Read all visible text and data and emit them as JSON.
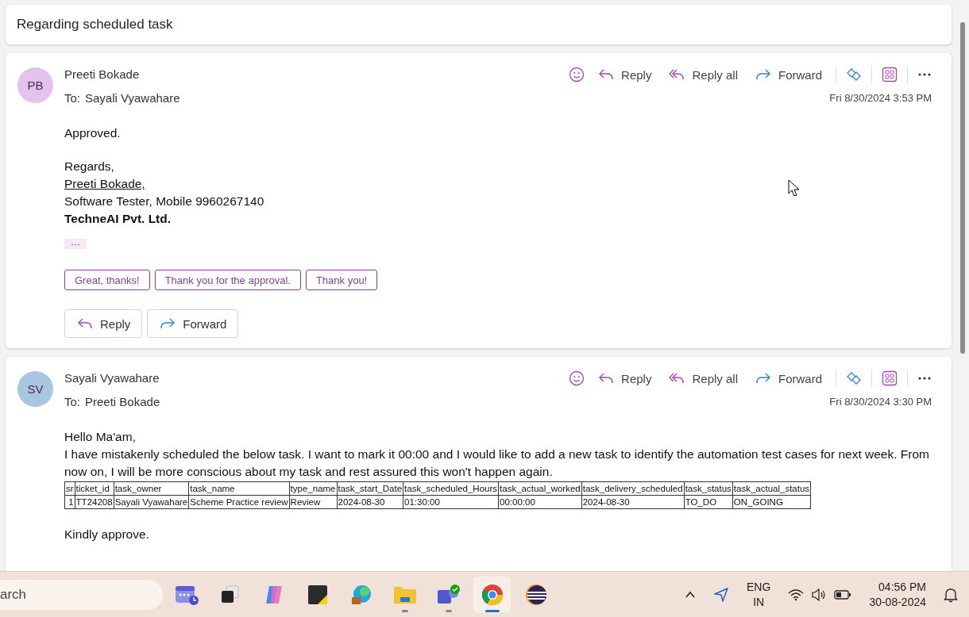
{
  "subject": "Regarding scheduled task",
  "messages": [
    {
      "initials": "PB",
      "color": "#e5c2ec",
      "sender": "Preeti Bokade",
      "to_label": "To:",
      "recipient": "Sayali Vyawahare",
      "date": "Fri 8/30/2024 3:53 PM",
      "actions": [
        {
          "kind": "reply",
          "label": "Reply"
        },
        {
          "kind": "reply-all",
          "label": "Reply all"
        },
        {
          "kind": "forward",
          "label": "Forward"
        }
      ],
      "body": [
        {
          "kind": "plain",
          "text": "Approved."
        },
        {
          "kind": "gap"
        },
        {
          "kind": "plain",
          "text": "Regards,"
        },
        {
          "kind": "link",
          "text": "Preeti Bokade,"
        },
        {
          "kind": "plain",
          "text": "Software Tester, Mobile 9960267140"
        },
        {
          "kind": "bold",
          "text": "TechneAI Pvt. Ltd."
        }
      ],
      "show_more": "···",
      "quick_replies": [
        "Great, thanks!",
        "Thank you for the approval.",
        "Thank you!"
      ],
      "footer_buttons": [
        {
          "kind": "reply",
          "label": "Reply"
        },
        {
          "kind": "forward",
          "label": "Forward"
        }
      ]
    },
    {
      "initials": "SV",
      "color": "#a9c6e0",
      "sender": "Sayali Vyawahare",
      "to_label": "To:",
      "recipient": "Preeti Bokade",
      "date": "Fri 8/30/2024 3:30 PM",
      "actions": [
        {
          "kind": "reply",
          "label": "Reply"
        },
        {
          "kind": "reply-all",
          "label": "Reply all"
        },
        {
          "kind": "forward",
          "label": "Forward"
        }
      ],
      "body": [
        {
          "kind": "plain",
          "text": "Hello Ma'am,"
        },
        {
          "kind": "plain",
          "text": "I have mistakenly scheduled the below task. I want to mark it 00:00 and I would like to add a new task to identify the automation test cases for next week. From now on, I will be more conscious about my task and rest assured this won't happen again."
        },
        {
          "kind": "table",
          "columns": [
            "sr",
            "ticket_id",
            "task_owner",
            "task_name",
            "type_name",
            "task_start_Date",
            "task_scheduled_Hours",
            "task_actual_worked",
            "task_delivery_scheduled",
            "task_status",
            "task_actual_status"
          ],
          "rows": [
            [
              "1",
              "TT24208",
              "Sayali Vyawahare",
              "Scheme Practice review",
              "Review",
              "2024-08-30",
              "01:30:00",
              "00:00:00",
              "2024-08-30",
              "TO_DO",
              "ON_GOING"
            ]
          ]
        },
        {
          "kind": "gap"
        },
        {
          "kind": "plain",
          "text": "Kindly approve."
        }
      ]
    }
  ],
  "taskbar": {
    "search_placeholder": "arch",
    "apps": [
      {
        "kind": "widgets",
        "running": false,
        "selected": false
      },
      {
        "kind": "task-view",
        "running": false,
        "selected": false
      },
      {
        "kind": "copilot",
        "running": false,
        "selected": false
      },
      {
        "kind": "notes",
        "running": false,
        "selected": false
      },
      {
        "kind": "edge",
        "running": false,
        "selected": false
      },
      {
        "kind": "files",
        "running": true,
        "selected": false
      },
      {
        "kind": "teams",
        "running": true,
        "selected": false
      },
      {
        "kind": "chrome",
        "running": true,
        "selected": true
      },
      {
        "kind": "eclipse",
        "running": false,
        "selected": false
      }
    ],
    "language": "ENG",
    "region": "IN",
    "time": "04:56 PM",
    "date": "30-08-2024"
  }
}
